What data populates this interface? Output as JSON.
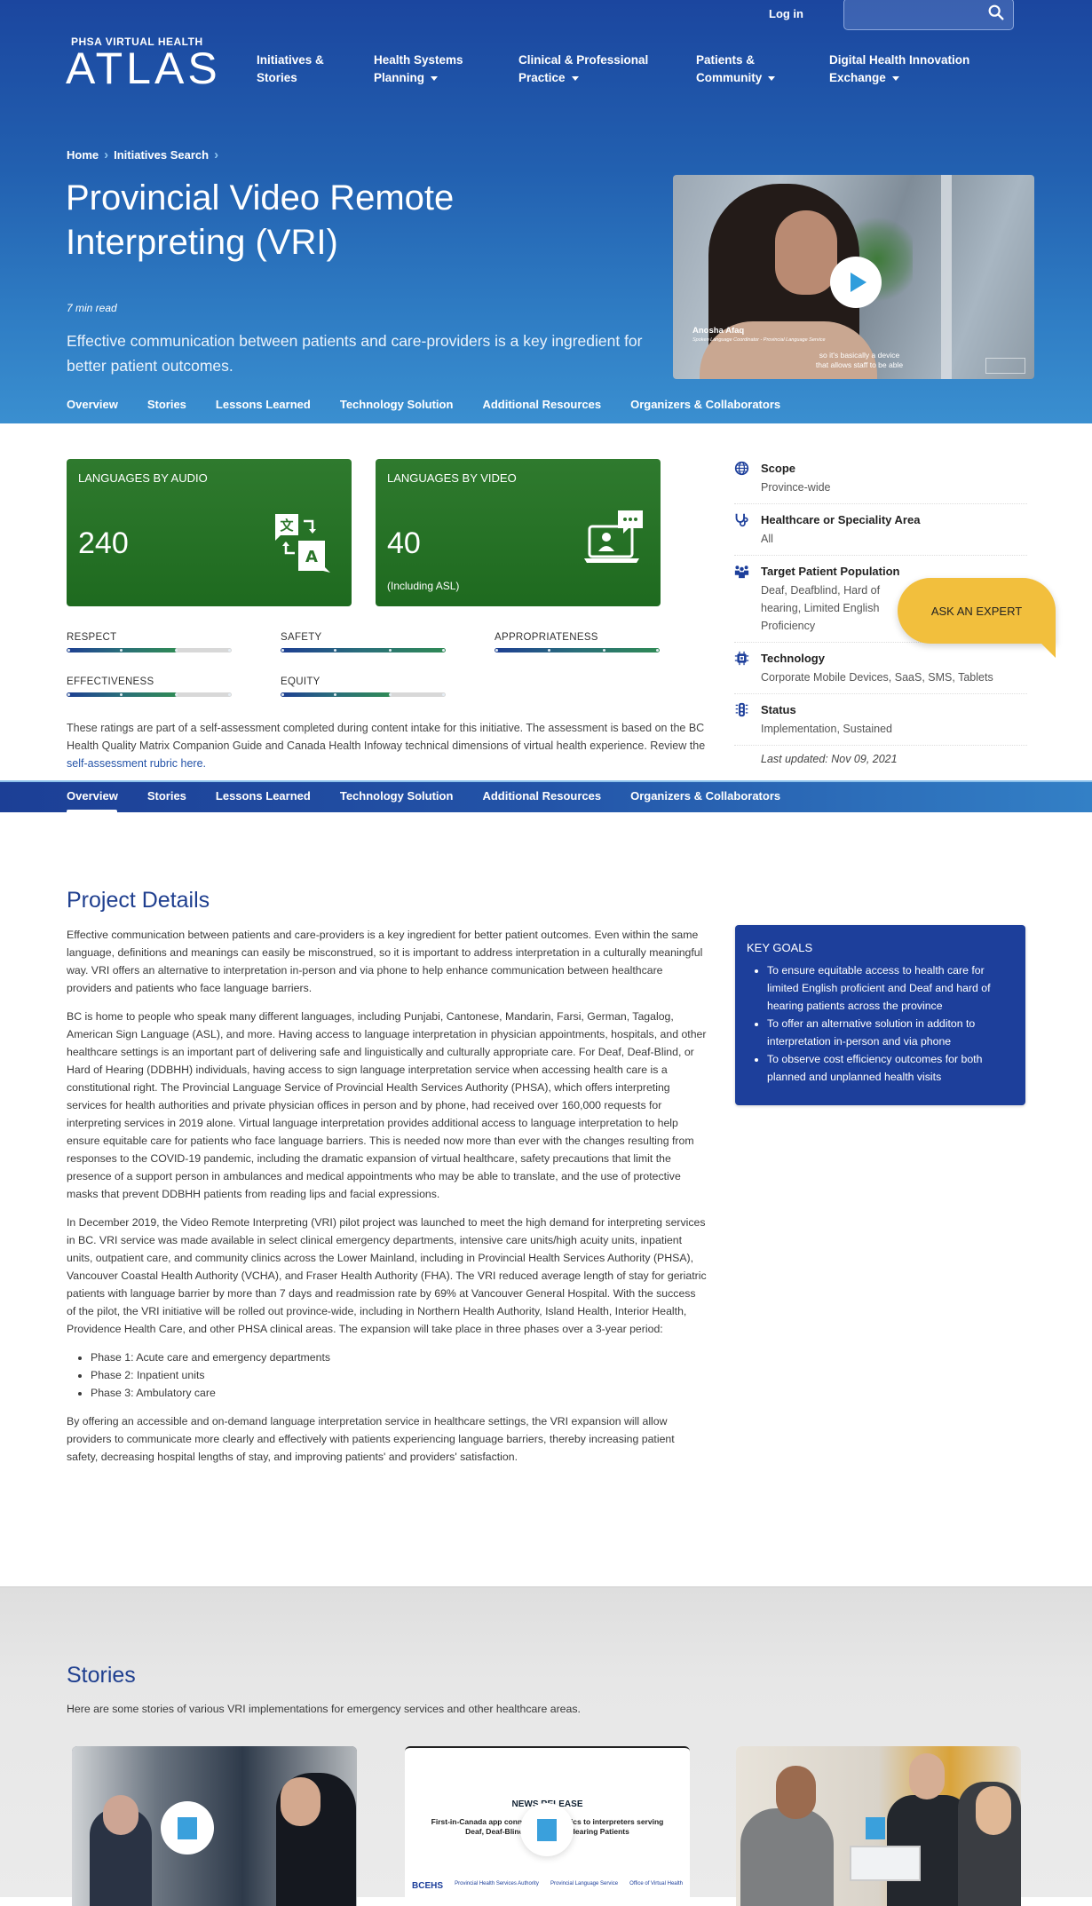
{
  "header": {
    "login_label": "Log in",
    "search_placeholder": "",
    "logo_top": "PHSA VIRTUAL HEALTH",
    "logo_main": "ATLAS",
    "nav": [
      {
        "label_line1": "Initiatives &",
        "label_line2": "Stories",
        "has_dropdown": false
      },
      {
        "label_line1": "Health Systems",
        "label_line2": "Planning",
        "has_dropdown": true
      },
      {
        "label_line1": "Clinical & Professional",
        "label_line2": "Practice",
        "has_dropdown": true
      },
      {
        "label_line1": "Patients &",
        "label_line2": "Community",
        "has_dropdown": true
      },
      {
        "label_line1": "Digital Health Innovation",
        "label_line2": "Exchange",
        "has_dropdown": true
      }
    ]
  },
  "hero": {
    "breadcrumb": [
      "Home",
      "Initiatives Search"
    ],
    "title": "Provincial Video Remote Interpreting (VRI)",
    "read_time": "7 min read",
    "lead": "Effective communication between patients and care-providers is a key ingredient for better patient outcomes.",
    "video": {
      "speaker_name": "Anosha Afaq",
      "speaker_role": "Spoken Language Coordinator - Provincial Language Service",
      "caption_line1": "so it's basically a device",
      "caption_line2": "that allows staff to be able"
    }
  },
  "tabs": [
    "Overview",
    "Stories",
    "Lessons Learned",
    "Technology Solution",
    "Additional Resources",
    "Organizers & Collaborators"
  ],
  "active_tab": "Overview",
  "stats": [
    {
      "label": "LANGUAGES BY AUDIO",
      "value": "240",
      "sub": "",
      "icon": "translate-icon"
    },
    {
      "label": "LANGUAGES BY VIDEO",
      "value": "40",
      "sub": "(Including ASL)",
      "icon": "video-call-icon"
    }
  ],
  "ratings": [
    {
      "label": "RESPECT",
      "score": 2,
      "max": 3
    },
    {
      "label": "SAFETY",
      "score": 3,
      "max": 3
    },
    {
      "label": "APPROPRIATENESS",
      "score": 3,
      "max": 3
    },
    {
      "label": "EFFECTIVENESS",
      "score": 2,
      "max": 3
    },
    {
      "label": "EQUITY",
      "score": 2,
      "max": 3
    }
  ],
  "rating_note": {
    "text": "These ratings are part of a self-assessment completed during content intake for this initiative. The assessment is based on the BC Health Quality Matrix Companion Guide and Canada Health Infoway technical dimensions of virtual health experience. Review the ",
    "link": "self-assessment rubric here."
  },
  "meta": [
    {
      "label": "Scope",
      "value": "Province-wide",
      "icon": "globe-icon"
    },
    {
      "label": "Healthcare or Speciality Area",
      "value": "All",
      "icon": "stethoscope-icon"
    },
    {
      "label": "Target Patient Population",
      "value": "Deaf, Deafblind, Hard of hearing, Limited English Proficiency",
      "icon": "people-icon"
    },
    {
      "label": "Technology",
      "value": "Corporate Mobile Devices, SaaS, SMS, Tablets",
      "icon": "chip-icon"
    },
    {
      "label": "Status",
      "value": "Implementation, Sustained",
      "icon": "traffic-light-icon"
    }
  ],
  "last_updated": "Last updated: Nov 09, 2021",
  "ask_expert_label": "ASK AN EXPERT",
  "project_details": {
    "title": "Project Details",
    "paragraphs": [
      "Effective communication between patients and care-providers is a key ingredient for better patient outcomes. Even within the same language, definitions and meanings can easily be misconstrued, so it is important to address interpretation in a culturally meaningful way. VRI offers an alternative to interpretation in-person and via phone to help enhance communication between healthcare providers and patients who face language barriers.",
      "BC is home to people who speak many different languages, including Punjabi, Cantonese, Mandarin, Farsi, German, Tagalog, American Sign Language (ASL), and more. Having access to language interpretation in physician appointments, hospitals, and other healthcare settings is an important part of delivering safe and linguistically and culturally appropriate care. For Deaf, Deaf-Blind, or Hard of Hearing (DDBHH) individuals, having access to sign language interpretation service when accessing health care is a constitutional right. The Provincial Language Service of Provincial Health Services Authority (PHSA), which offers interpreting services for health authorities and private physician offices in person and by phone, had received over 160,000 requests for interpreting services in 2019 alone. Virtual language interpretation provides additional access to language interpretation to help ensure equitable care for patients who face language barriers. This is needed now more than ever with the changes resulting from responses to the COVID-19 pandemic, including the dramatic expansion of virtual healthcare, safety precautions that limit the presence of a support person in ambulances and medical appointments who may be able to translate, and the use of protective masks that prevent DDBHH patients from reading lips and facial expressions.",
      "In December 2019, the Video Remote Interpreting (VRI) pilot project was launched to meet the high demand for interpreting services in BC. VRI service was made available in select clinical emergency departments, intensive care units/high acuity units, inpatient units, outpatient care, and community clinics across the Lower Mainland, including in Provincial Health Services Authority (PHSA), Vancouver Coastal Health Authority (VCHA), and Fraser Health Authority (FHA). The VRI reduced average length of stay for geriatric patients with language barrier by more than 7 days and readmission rate by 69% at Vancouver General Hospital. With the success of the pilot, the VRI initiative will be rolled out province-wide, including in Northern Health Authority, Island Health, Interior Health, Providence Health Care, and other PHSA clinical areas. The expansion will take place in three phases over a 3-year period:"
    ],
    "phases": [
      "Phase 1: Acute care and emergency departments",
      "Phase 2: Inpatient units",
      "Phase 3: Ambulatory care"
    ],
    "closing": "By offering an accessible and on-demand language interpretation service in healthcare settings, the VRI expansion will allow providers to communicate more clearly and effectively with patients experiencing language barriers, thereby increasing patient safety, decreasing hospital lengths of stay, and improving patients' and providers' satisfaction."
  },
  "key_goals": {
    "title": "KEY GOALS",
    "items": [
      "To ensure equitable access to health care for limited English proficient and Deaf and hard of hearing patients across the province",
      "To offer an alternative solution in additon to interpretation in-person and via phone",
      "To observe cost efficiency outcomes for both planned and unplanned health visits"
    ]
  },
  "stories": {
    "title": "Stories",
    "intro": "Here are some stories of various VRI implementations for emergency services and other healthcare areas.",
    "cards": [
      {
        "kind": "photo",
        "alt": "Paramedic using VRI app in ambulance"
      },
      {
        "kind": "news",
        "heading": "NEWS RELEASE",
        "headline_line1": "First-in-Canada app connects paramedics to interpreters serving",
        "headline_line2": "Deaf, Deaf-Blind and Hard of Hearing Patients",
        "logos": [
          "BCEHS",
          "Provincial Health Services Authority",
          "Provincial Language Service",
          "Office of Virtual Health"
        ]
      },
      {
        "kind": "photo",
        "alt": "Staff with VRI tablet cart"
      }
    ]
  },
  "colors": {
    "brand_blue": "#1d3f9b",
    "stat_green": "#2a7529",
    "accent_yellow": "#f2bf3d",
    "link_blue": "#2453a8",
    "play_blue": "#2f9ddc"
  }
}
